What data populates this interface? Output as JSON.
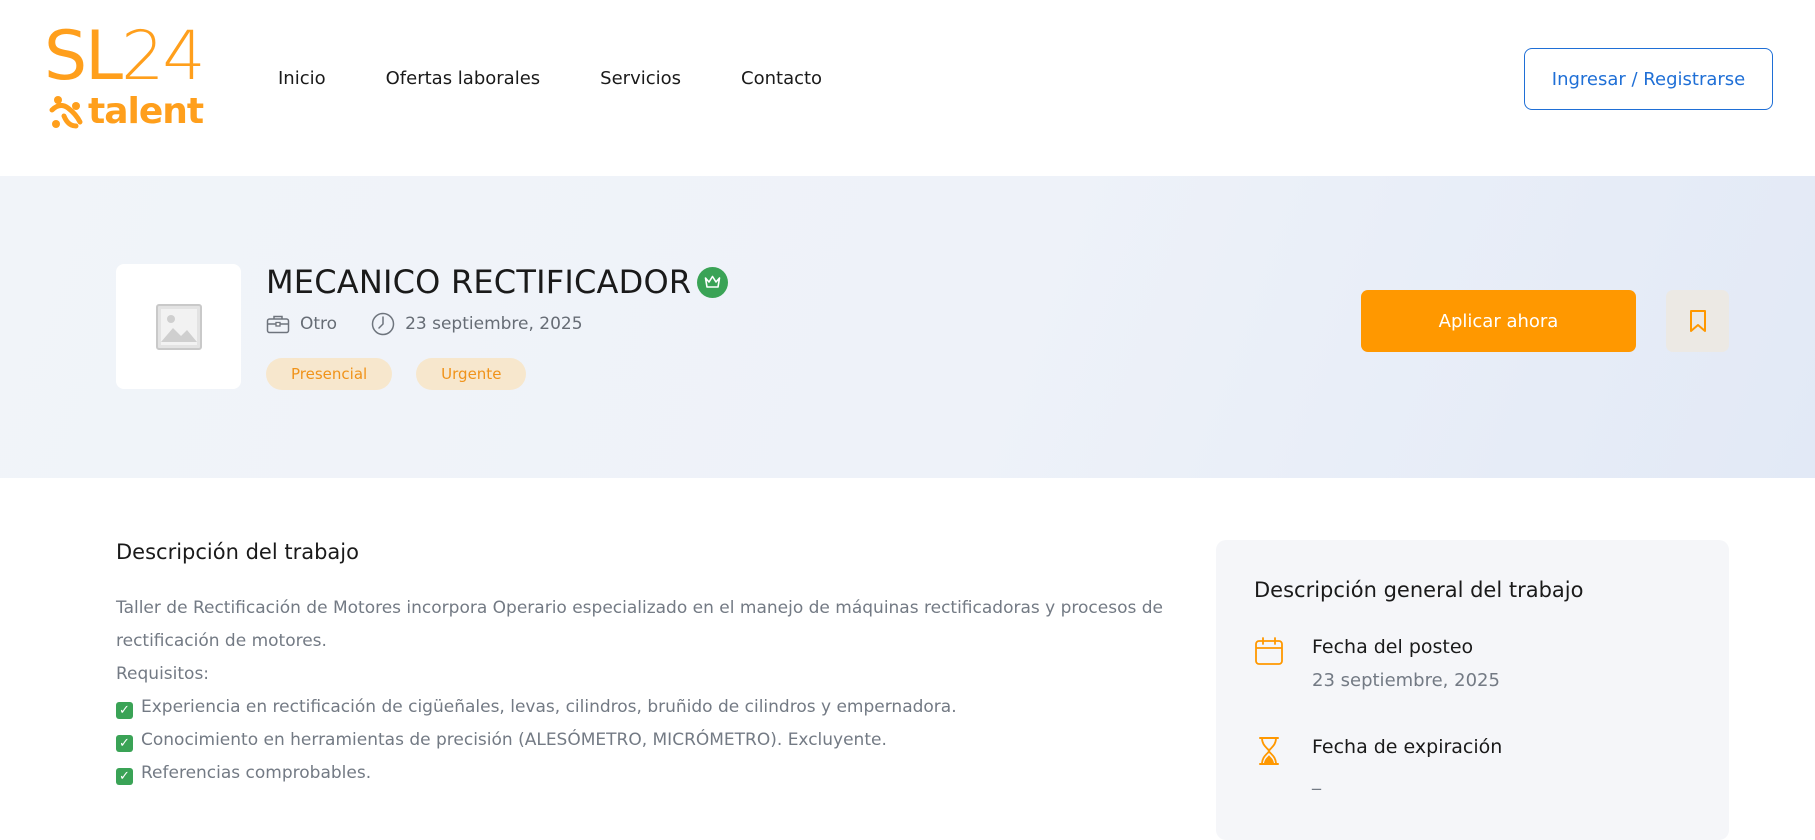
{
  "brand": {
    "logo_text_top_sl": "SL",
    "logo_text_top_num": "24",
    "logo_text_bottom": "talent",
    "accent": "#ff9f1c"
  },
  "nav": {
    "items": [
      "Inicio",
      "Ofertas laborales",
      "Servicios",
      "Contacto"
    ]
  },
  "header": {
    "login_label": "Ingresar / Registrarse"
  },
  "job": {
    "title": "MECANICO RECTIFICADOR",
    "category": "Otro",
    "date": "23 septiembre, 2025",
    "tags": [
      "Presencial",
      "Urgente"
    ],
    "apply_label": "Aplicar ahora",
    "icons": {
      "category": "briefcase-icon",
      "date": "clock-icon",
      "badge": "crown-icon",
      "save": "bookmark-icon",
      "thumb": "image-placeholder-icon"
    }
  },
  "description": {
    "heading": "Descripción del trabajo",
    "lines": [
      "Taller de Rectificación de Motores incorpora Operario especializado en el manejo de máquinas rectificadoras y procesos de",
      "rectificación de motores.",
      "Requisitos:"
    ],
    "requirements": [
      "Experiencia en rectificación de cigüeñales, levas, cilindros, bruñido de cilindros y empernadora.",
      "Conocimiento en herramientas de precisión (ALESÓMETRO, MICRÓMETRO). Excluyente.",
      "Referencias comprobables."
    ]
  },
  "overview": {
    "title": "Descripción general del trabajo",
    "posted_label": "Fecha del posteo",
    "posted_value": "23 septiembre, 2025",
    "expiry_label": "Fecha de expiración",
    "expiry_value": "_"
  },
  "colors": {
    "primary_orange": "#ff9800",
    "link_blue": "#1f6fd6",
    "badge_green": "#3aa356",
    "tag_bg": "#f7e7cd"
  }
}
